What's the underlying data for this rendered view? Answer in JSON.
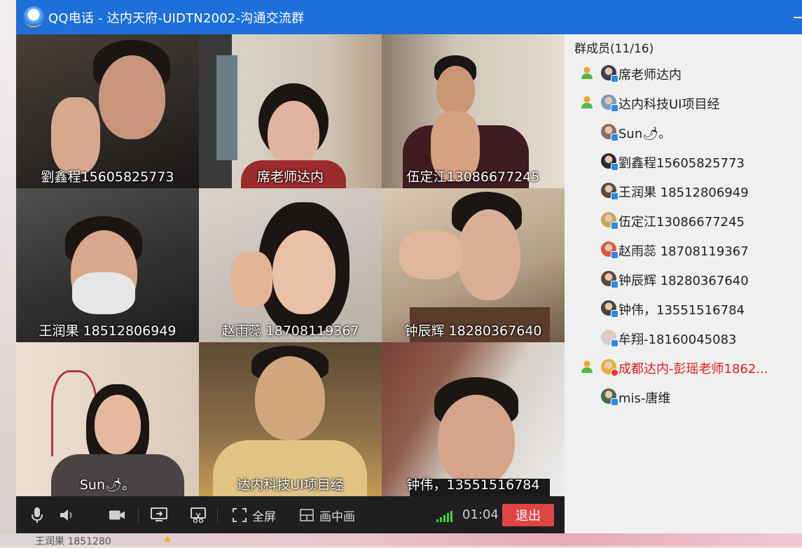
{
  "window": {
    "title": "QQ电话 - 达内天府-UIDTN2002-沟通交流群"
  },
  "videos": [
    {
      "name": "劉鑫程15605825773"
    },
    {
      "name": "席老师达内"
    },
    {
      "name": "伍定江13086677245"
    },
    {
      "name": "王润果 18512806949"
    },
    {
      "name": "赵雨蕊 18708119367"
    },
    {
      "name": "钟辰辉  18280367640"
    },
    {
      "name": "Sun🌶。"
    },
    {
      "name": "达内科技UI项目经"
    },
    {
      "name": "钟伟，13551516784"
    }
  ],
  "toolbar": {
    "fullscreen_label": "全屏",
    "pip_label": "画中画",
    "timer": "01:04",
    "exit_label": "退出"
  },
  "members_panel": {
    "title": "群成员(11/16)",
    "members": [
      {
        "name": "席老师达内",
        "role": "admin"
      },
      {
        "name": "达内科技UI项目经",
        "role": "admin"
      },
      {
        "name": "Sun🌶。",
        "role": ""
      },
      {
        "name": "劉鑫程15605825773",
        "role": ""
      },
      {
        "name": "王润果 18512806949",
        "role": ""
      },
      {
        "name": "伍定江13086677245",
        "role": ""
      },
      {
        "name": "赵雨蕊 18708119367",
        "role": ""
      },
      {
        "name": "钟辰辉  18280367640",
        "role": ""
      },
      {
        "name": "钟伟，13551516784",
        "role": ""
      },
      {
        "name": "牟翔-18160045083",
        "role": ""
      },
      {
        "name": "成都达内-彭瑶老师1862...",
        "role": "admin"
      },
      {
        "name": "mis-唐维",
        "role": ""
      }
    ]
  },
  "background": {
    "partial_text": "王润果 1851280"
  }
}
